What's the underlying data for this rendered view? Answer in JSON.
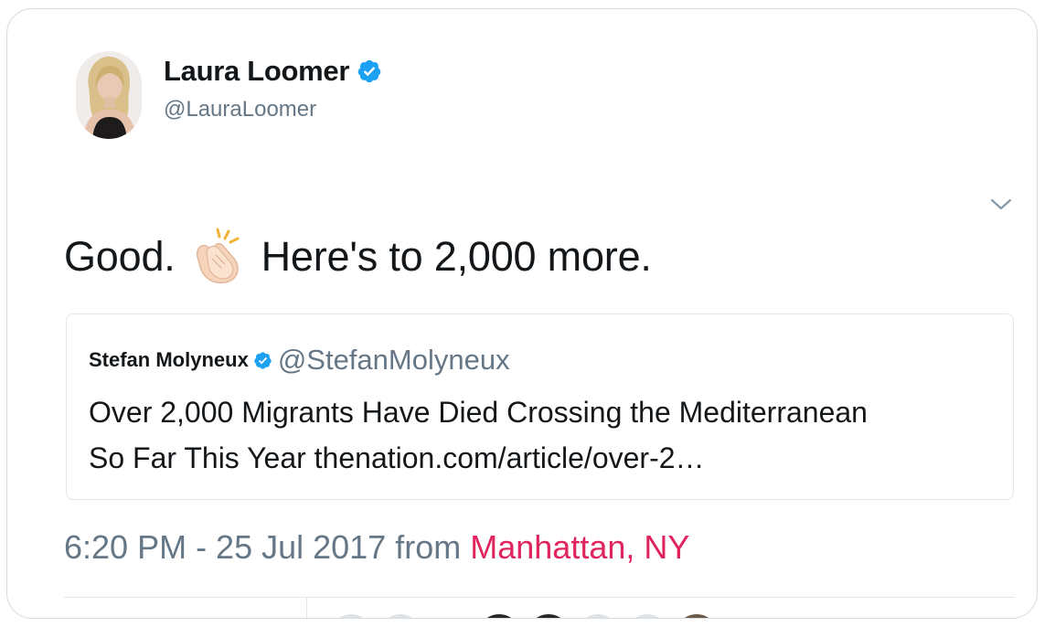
{
  "author": {
    "name": "Laura Loomer",
    "handle": "@LauraLoomer",
    "verified_color": "#1da1f2"
  },
  "tweet": {
    "text_before": "Good.",
    "emoji": "clapping-hands-icon",
    "text_after": "Here's to 2,000 more."
  },
  "quoted_tweet": {
    "name": "Stefan Molyneux",
    "handle": "@StefanMolyneux",
    "line1": "Over 2,000 Migrants Have Died Crossing the Mediterranean",
    "line2": "So Far This Year  thenation.com/article/over-2…"
  },
  "meta": {
    "timestamp": "6:20 PM - 25 Jul 2017",
    "from_label": "from",
    "location": "Manhattan, NY",
    "location_color": "#e0245e"
  }
}
